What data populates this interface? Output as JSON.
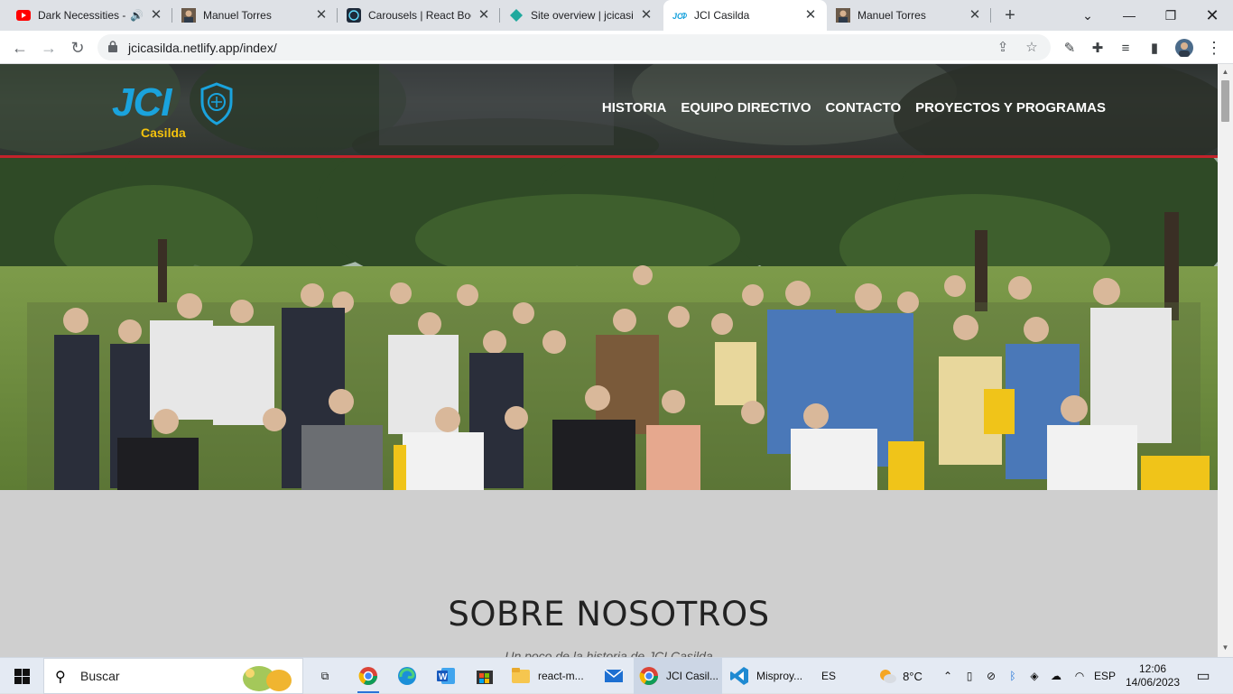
{
  "tabs": [
    {
      "title": "Dark Necessities -",
      "icon": "youtube-icon",
      "audio": true
    },
    {
      "title": "Manuel Torres",
      "icon": "profile-photo-icon"
    },
    {
      "title": "Carousels | React Boot",
      "icon": "react-bootstrap-icon"
    },
    {
      "title": "Site overview | jcicasild",
      "icon": "netlify-icon"
    },
    {
      "title": "JCI Casilda",
      "icon": "jci-favicon-icon",
      "active": true
    },
    {
      "title": "Manuel Torres",
      "icon": "profile-photo-icon"
    }
  ],
  "address_bar": {
    "url": "jcicasilda.netlify.app/index/"
  },
  "site": {
    "logo": {
      "text": "JCI",
      "sub": "Casilda"
    },
    "nav": [
      "HISTORIA",
      "EQUIPO DIRECTIVO",
      "CONTACTO",
      "PROYECTOS Y PROGRAMAS"
    ],
    "about": {
      "title": "SOBRE NOSOTROS",
      "subtitle": "Un poco de la historia de JCI Casilda"
    },
    "colors": {
      "brand_blue": "#1aa3dd",
      "brand_yellow": "#f4c20d",
      "accent_red": "#c4232b"
    }
  },
  "taskbar": {
    "search_label": "Buscar",
    "apps": [
      {
        "name": "task-view-icon"
      },
      {
        "name": "chrome-icon"
      },
      {
        "name": "edge-icon"
      },
      {
        "name": "word-icon"
      },
      {
        "name": "store-icon"
      },
      {
        "name": "folder-icon",
        "label": "react-m..."
      },
      {
        "name": "mail-icon"
      },
      {
        "name": "chrome-icon",
        "label": "JCI Casil..."
      },
      {
        "name": "vscode-icon",
        "label": "Misproy..."
      }
    ],
    "lang_left": "ES",
    "weather": "8°C",
    "lang_right": "ESP",
    "time": "12:06",
    "date": "14/06/2023"
  }
}
